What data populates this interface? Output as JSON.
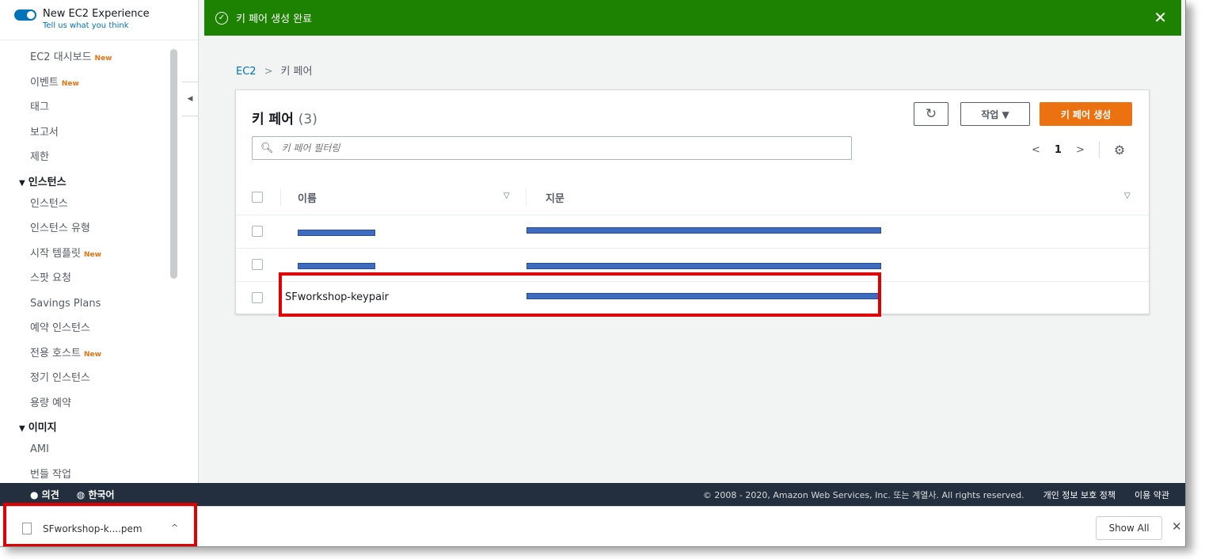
{
  "sidebar": {
    "experience_title": "New EC2 Experience",
    "experience_link": "Tell us what you think",
    "items": [
      {
        "label": "EC2 대시보드",
        "badge": "New"
      },
      {
        "label": "이벤트",
        "badge": "New"
      },
      {
        "label": "태그",
        "badge": ""
      },
      {
        "label": "보고서",
        "badge": ""
      },
      {
        "label": "제한",
        "badge": ""
      }
    ],
    "section_instances": "인스턴스",
    "instances_items": [
      {
        "label": "인스턴스",
        "badge": ""
      },
      {
        "label": "인스턴스 유형",
        "badge": ""
      },
      {
        "label": "시작 템플릿",
        "badge": "New"
      },
      {
        "label": "스팟 요청",
        "badge": ""
      },
      {
        "label": "Savings Plans",
        "badge": ""
      },
      {
        "label": "예약 인스턴스",
        "badge": ""
      },
      {
        "label": "전용 호스트",
        "badge": "New"
      },
      {
        "label": "정기 인스턴스",
        "badge": ""
      },
      {
        "label": "용량 예약",
        "badge": ""
      }
    ],
    "section_images": "이미지",
    "images_items": [
      {
        "label": "AMI",
        "badge": ""
      },
      {
        "label": "번들 작업",
        "badge": ""
      }
    ]
  },
  "flash": {
    "message": "키 페어 생성 완료",
    "close": "✕",
    "color": "#1d8102"
  },
  "breadcrumb": {
    "root": "EC2",
    "current": "키 페어"
  },
  "panel": {
    "title": "키 페어",
    "count": "(3)",
    "actions_label": "작업 ▼",
    "create_label": "키 페어 생성",
    "search_placeholder": "키 페어 필터링",
    "page": "1",
    "col_name": "이름",
    "col_fingerprint": "지문",
    "rows": [
      {
        "name": "",
        "fingerprint": "",
        "redacted": true
      },
      {
        "name": "",
        "fingerprint": "",
        "redacted": true
      },
      {
        "name": "SFworkshop-keypair",
        "fingerprint": "",
        "redacted": false
      }
    ]
  },
  "footer": {
    "feedback": "의견",
    "language": "한국어",
    "copyright": "© 2008 - 2020, Amazon Web Services, Inc. 또는 계열사. All rights reserved.",
    "privacy": "개인 정보 보호 정책",
    "terms": "이용 약관"
  },
  "download": {
    "filename": "SFworkshop-k....pem",
    "show_all": "Show All"
  },
  "colors": {
    "accent": "#0073bb",
    "primary_button": "#ec7211",
    "highlight": "#e00000",
    "footer": "#232f3e"
  }
}
